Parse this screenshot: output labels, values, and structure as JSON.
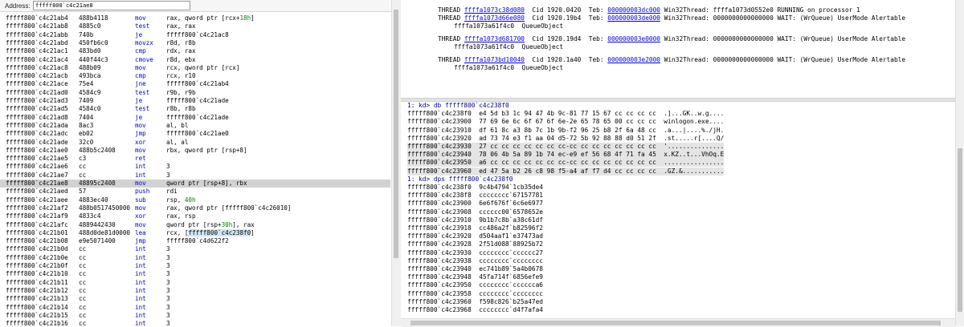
{
  "address_bar": {
    "label": "Address:",
    "value": "fffff800`c4c21ae8"
  },
  "disassembly": [
    {
      "addr": "fffff800`c4c21ab4",
      "bytes": "488b4118",
      "mnemonic": "mov",
      "operands": "rax, qword ptr [rcx+",
      "imm": "18h",
      "tail": "]"
    },
    {
      "addr": "fffff800`c4c21ab8",
      "bytes": "4885c0",
      "mnemonic": "test",
      "operands": "rax, rax"
    },
    {
      "addr": "fffff800`c4c21abb",
      "bytes": "740b",
      "mnemonic": "je",
      "operands": "fffff800`c4c21ac8"
    },
    {
      "addr": "fffff800`c4c21abd",
      "bytes": "450fb6c0",
      "mnemonic": "movzx",
      "operands": "r8d, r8b"
    },
    {
      "addr": "fffff800`c4c21ac1",
      "bytes": "483bd0",
      "mnemonic": "cmp",
      "operands": "rdx, rax"
    },
    {
      "addr": "fffff800`c4c21ac4",
      "bytes": "440f44c3",
      "mnemonic": "cmove",
      "operands": "r8d, ebx"
    },
    {
      "addr": "fffff800`c4c21ac8",
      "bytes": "488b09",
      "mnemonic": "mov",
      "operands": "rcx, qword ptr [rcx]"
    },
    {
      "addr": "fffff800`c4c21acb",
      "bytes": "493bca",
      "mnemonic": "cmp",
      "operands": "rcx, r10"
    },
    {
      "addr": "fffff800`c4c21ace",
      "bytes": "75e4",
      "mnemonic": "jne",
      "operands": "fffff800`c4c21ab4"
    },
    {
      "addr": "fffff800`c4c21ad0",
      "bytes": "4584c9",
      "mnemonic": "test",
      "operands": "r9b, r9b"
    },
    {
      "addr": "fffff800`c4c21ad3",
      "bytes": "7409",
      "mnemonic": "je",
      "operands": "fffff800`c4c21ade"
    },
    {
      "addr": "fffff800`c4c21ad5",
      "bytes": "4584c0",
      "mnemonic": "test",
      "operands": "r8b, r8b"
    },
    {
      "addr": "fffff800`c4c21ad8",
      "bytes": "7404",
      "mnemonic": "je",
      "operands": "fffff800`c4c21ade"
    },
    {
      "addr": "fffff800`c4c21ada",
      "bytes": "8ac3",
      "mnemonic": "mov",
      "operands": "al, bl"
    },
    {
      "addr": "fffff800`c4c21adc",
      "bytes": "eb02",
      "mnemonic": "jmp",
      "operands": "fffff800`c4c21ae0"
    },
    {
      "addr": "fffff800`c4c21ade",
      "bytes": "32c0",
      "mnemonic": "xor",
      "operands": "al, al"
    },
    {
      "addr": "fffff800`c4c21ae0",
      "bytes": "488b5c2408",
      "mnemonic": "mov",
      "operands": "rbx, qword ptr [rsp+8]"
    },
    {
      "addr": "fffff800`c4c21ae5",
      "bytes": "c3",
      "mnemonic": "ret",
      "operands": ""
    },
    {
      "addr": "fffff800`c4c21ae6",
      "bytes": "cc",
      "mnemonic": "int",
      "operands": "3"
    },
    {
      "addr": "fffff800`c4c21ae7",
      "bytes": "cc",
      "mnemonic": "int",
      "operands": "3"
    },
    {
      "addr": "fffff800`c4c21ae8",
      "bytes": "48895c2408",
      "mnemonic": "mov",
      "operands": "qword ptr [rsp+8], rbx",
      "selected": true
    },
    {
      "addr": "fffff800`c4c21aed",
      "bytes": "57",
      "mnemonic": "push",
      "operands": "rdi"
    },
    {
      "addr": "fffff800`c4c21aee",
      "bytes": "4883ec40",
      "mnemonic": "sub",
      "operands": "rsp, ",
      "imm": "40h",
      "tail": ""
    },
    {
      "addr": "fffff800`c4c21af2",
      "bytes": "488b0517450000",
      "mnemonic": "mov",
      "operands": "rax, qword ptr [fffff800`c4c26010]"
    },
    {
      "addr": "fffff800`c4c21af9",
      "bytes": "4833c4",
      "mnemonic": "xor",
      "operands": "rax, rsp"
    },
    {
      "addr": "fffff800`c4c21afc",
      "bytes": "4889442430",
      "mnemonic": "mov",
      "operands": "qword ptr [rsp+",
      "imm": "30h",
      "tail": "], rax"
    },
    {
      "addr": "fffff800`c4c21b01",
      "bytes": "488d0de81d0000",
      "mnemonic": "lea",
      "operands": "rcx, [",
      "hl": "fffff800`c4c238f0",
      "tail": "]"
    },
    {
      "addr": "fffff800`c4c21b08",
      "bytes": "e9e5071400",
      "mnemonic": "jmp",
      "operands": "fffff800`c4d622f2"
    },
    {
      "addr": "fffff800`c4c21b0d",
      "bytes": "cc",
      "mnemonic": "int",
      "operands": "3"
    },
    {
      "addr": "fffff800`c4c21b0e",
      "bytes": "cc",
      "mnemonic": "int",
      "operands": "3"
    },
    {
      "addr": "fffff800`c4c21b0f",
      "bytes": "cc",
      "mnemonic": "int",
      "operands": "3"
    },
    {
      "addr": "fffff800`c4c21b10",
      "bytes": "cc",
      "mnemonic": "int",
      "operands": "3"
    },
    {
      "addr": "fffff800`c4c21b11",
      "bytes": "cc",
      "mnemonic": "int",
      "operands": "3"
    },
    {
      "addr": "fffff800`c4c21b12",
      "bytes": "cc",
      "mnemonic": "int",
      "operands": "3"
    },
    {
      "addr": "fffff800`c4c21b13",
      "bytes": "cc",
      "mnemonic": "int",
      "operands": "3"
    },
    {
      "addr": "fffff800`c4c21b14",
      "bytes": "cc",
      "mnemonic": "int",
      "operands": "3"
    },
    {
      "addr": "fffff800`c4c21b15",
      "bytes": "cc",
      "mnemonic": "int",
      "operands": "3"
    },
    {
      "addr": "fffff800`c4c21b16",
      "bytes": "cc",
      "mnemonic": "int",
      "operands": "3"
    }
  ],
  "threads": [
    {
      "pre": "THREAD ",
      "link": "ffffa1073c38d080",
      "mid": "  Cid 1920.0420  Teb: ",
      "teb": "000000003dc000",
      "post": " Win32Thread: ffffa1073d0552e0 RUNNING on processor 1",
      "cont": ""
    },
    {
      "pre": "THREAD ",
      "link": "ffffa1073d66e080",
      "mid": "  Cid 1920.19b4  Teb: ",
      "teb": "000000003de000",
      "post": " Win32Thread: 0000000000000000 WAIT: (WrQueue) UserMode Alertable",
      "cont": "ffffa1073a61f4c0  QueueObject"
    },
    {
      "pre": "THREAD ",
      "link": "ffffa1073d681700",
      "mid": "  Cid 1920.19d4  Teb: ",
      "teb": "000000003e0000",
      "post": " Win32Thread: 0000000000000000 WAIT: (WrQueue) UserMode Alertable",
      "cont": "ffffa1073a61f4c0  QueueObject"
    },
    {
      "pre": "THREAD ",
      "link": "ffffa1073bd10040",
      "mid": "  Cid 1920.1a40  Teb: ",
      "teb": "000000003e2000",
      "post": " Win32Thread: 0000000000000000 WAIT: (WrQueue) UserMode Alertable",
      "cont": "ffffa1073a61f4c0  QueueObject"
    }
  ],
  "command_output": [
    {
      "text": "1: kd> db fffff800`c4c238f0",
      "prompt": true
    },
    {
      "text": "fffff800`c4c238f0  e4 5d b3 1c 94 47 4b 9c-81 77 15 67 cc cc cc cc  .]...GK..w.g...."
    },
    {
      "text": "fffff800`c4c23900  77 69 6e 6c 6f 67 6f 6e-2e 65 78 65 00 cc cc cc  winlogon.exe...."
    },
    {
      "text": "fffff800`c4c23910  df 61 8c a3 8b 7c 1b 9b-f2 96 25 b8 2f 6a 48 cc  .a...|....%./jH."
    },
    {
      "text": "fffff800`c4c23920  ad 73 74 e3 f1 aa 04 d5-72 5b 92 88 88 d0 51 2f  .st.....r[....Q/"
    },
    {
      "text": "fffff800`c4c23930  27 cc cc cc cc cc cc cc-cc cc cc cc cc cc cc cc  '..............."
    },
    {
      "text": "fffff800`c4c23940  78 06 4b 5a 89 1b 74 ec-e9 ef 56 68 4f 71 fa 45  x.KZ..t...VhOq.E"
    },
    {
      "text": "fffff800`c4c23950  a6 cc cc cc cc cc cc cc-cc cc cc cc cc cc cc cc  ................"
    },
    {
      "text": "fffff800`c4c23960  ed 47 5a b2 26 c8 98 f5-a4 af f7 d4 cc cc cc cc  .GZ.&..........."
    },
    {
      "text": "1: kd> dps fffff800`c4c238f0",
      "prompt": true
    },
    {
      "text": "fffff800`c4c238f0  9c4b4794`1cb35de4"
    },
    {
      "text": "fffff800`c4c238f8  cccccccc`67157781"
    },
    {
      "text": "fffff800`c4c23900  6e6f676f`6c6e6977"
    },
    {
      "text": "fffff800`c4c23908  cccccc00`6578652e"
    },
    {
      "text": "fffff800`c4c23910  9b1b7c8b`a38c61df"
    },
    {
      "text": "fffff800`c4c23918  cc486a2f`b82596f2"
    },
    {
      "text": "fffff800`c4c23920  d504aaf1`e37473ad"
    },
    {
      "text": "fffff800`c4c23928  2f51d088`88925b72"
    },
    {
      "text": "fffff800`c4c23930  cccccccc`cccccc27"
    },
    {
      "text": "fffff800`c4c23938  cccccccc`cccccccc"
    },
    {
      "text": "fffff800`c4c23940  ec741b89`5a4b0678"
    },
    {
      "text": "fffff800`c4c23948  45fa714f`6856efe9"
    },
    {
      "text": "fffff800`c4c23950  cccccccc`cccccca6"
    },
    {
      "text": "fffff800`c4c23958  cccccccc`cccccccc"
    },
    {
      "text": "fffff800`c4c23960  f598c826`b25a47ed"
    },
    {
      "text": "fffff800`c4c23968  cccccccc`d4f7afa4"
    }
  ]
}
